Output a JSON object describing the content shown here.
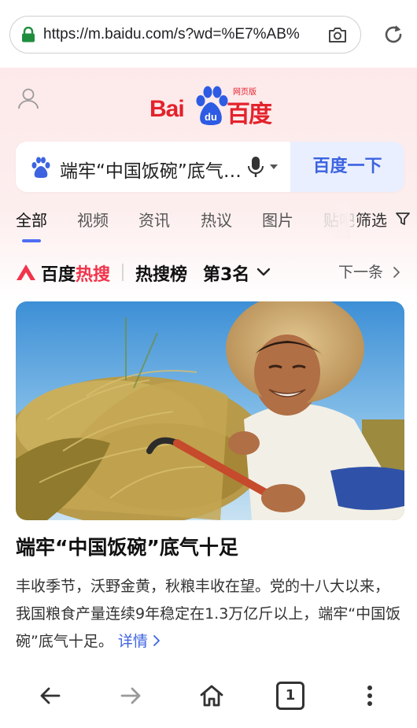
{
  "browser": {
    "url": "https://m.baidu.com/s?wd=%E7%AB%",
    "tab_count": "1"
  },
  "header": {
    "logo_bai": "Bai",
    "logo_du": "du",
    "logo_cn": "百度",
    "logo_sub": "网页版"
  },
  "search": {
    "query": "端牢“中国饭碗”底气十足",
    "button_label": "百度一下"
  },
  "tabs": [
    {
      "label": "全部"
    },
    {
      "label": "视频"
    },
    {
      "label": "资讯"
    },
    {
      "label": "热议"
    },
    {
      "label": "图片"
    },
    {
      "label": "贴吧"
    }
  ],
  "filter_label": "筛选",
  "hot": {
    "brand_prefix": "百度",
    "brand_hot": "热搜",
    "list_label": "热搜榜",
    "rank": "第3名",
    "next_label": "下一条"
  },
  "article": {
    "title": "端牢“中国饭碗”底气十足",
    "summary": "丰收季节，沃野金黄，秋粮丰收在望。党的十八大以来，我国粮食产量连续9年稳定在1.3万亿斤以上，端牢“中国饭碗”底气十足。",
    "link_label": "详情"
  },
  "colors": {
    "brand_red": "#e3222c",
    "brand_blue": "#3d63e0",
    "hot_red": "#f2334b"
  }
}
